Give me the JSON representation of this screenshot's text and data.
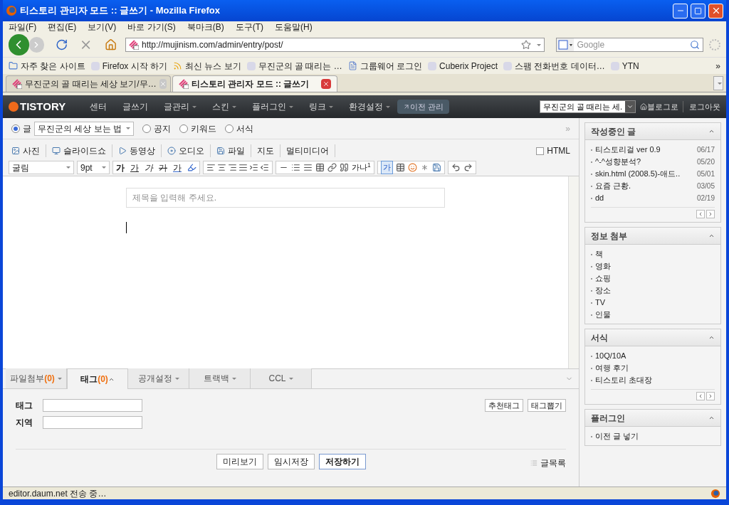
{
  "window": {
    "title": "티스토리 관리자 모드 :: 글쓰기 - Mozilla Firefox"
  },
  "menu": [
    "파일(F)",
    "편집(E)",
    "보기(V)",
    "바로 가기(S)",
    "북마크(B)",
    "도구(T)",
    "도움말(H)"
  ],
  "address": {
    "value": "http://mujinism.com/admin/entry/post/"
  },
  "search": {
    "placeholder": "Google"
  },
  "bookmarks": [
    "자주 찾은 사이트",
    "Firefox 시작 하기",
    "최신 뉴스 보기",
    "무진군의 골 때리는 …",
    "그룹웨어 로그인",
    "Cuberix Project",
    "스팸 전화번호 데이터…",
    "YTN"
  ],
  "bookmarks_more": "»",
  "tabs": [
    {
      "label": "무진군의 골 때리는 세상 보기/무…",
      "selected": false
    },
    {
      "label": "티스토리 관리자 모드 :: 글쓰기",
      "selected": true
    }
  ],
  "site_nav": {
    "logo": "TISTORY",
    "items": [
      {
        "label": "센터",
        "dropdown": false
      },
      {
        "label": "글쓰기",
        "dropdown": false
      },
      {
        "label": "글관리",
        "dropdown": true
      },
      {
        "label": "스킨",
        "dropdown": true
      },
      {
        "label": "플러그인",
        "dropdown": true
      },
      {
        "label": "링크",
        "dropdown": true
      },
      {
        "label": "환경설정",
        "dropdown": true
      }
    ],
    "old_admin": "이전 관리",
    "blog_select": "무진군의 골 때리는 세.",
    "blog_link": "블로그로",
    "logout": "로그아웃"
  },
  "post_types": [
    {
      "label": "글",
      "selected": true
    },
    {
      "label": "공지",
      "selected": false
    },
    {
      "label": "키워드",
      "selected": false
    },
    {
      "label": "서식",
      "selected": false
    }
  ],
  "category": "무진군의 세상 보는 법",
  "collapse": "»",
  "attach": [
    "사진",
    "슬라이드쇼",
    "동영상",
    "오디오",
    "파일",
    "지도",
    "멀티미디어"
  ],
  "html_mode": {
    "label": "HTML",
    "checked": false
  },
  "font": "굴림",
  "font_size": "9pt",
  "text_buttons": [
    {
      "label": "가",
      "kind": "bold"
    },
    {
      "label": "가",
      "kind": "underline"
    },
    {
      "label": "가",
      "kind": "italic"
    },
    {
      "label": "가",
      "kind": "strike"
    },
    {
      "label": "가",
      "kind": "color"
    }
  ],
  "footnote": "가나$^{1}$",
  "box_button": "가",
  "title_field": {
    "placeholder": "제목을 입력해 주세요."
  },
  "bottom_tabs": [
    {
      "label": "파일첨부",
      "count": "(0)",
      "selected": false
    },
    {
      "label": "태그",
      "count": "(0)",
      "selected": true
    },
    {
      "label": "공개설정",
      "selected": false
    },
    {
      "label": "트랙백",
      "selected": false
    },
    {
      "label": "CCL",
      "selected": false
    }
  ],
  "tag_form": {
    "fields": [
      "태그",
      "지역"
    ],
    "buttons": [
      "추천태그",
      "태그뽑기"
    ]
  },
  "actions": [
    {
      "label": "미리보기",
      "primary": false
    },
    {
      "label": "임시저장",
      "primary": false
    },
    {
      "label": "저장하기",
      "primary": true
    }
  ],
  "list_link": "글목록",
  "sidebar": [
    {
      "title": "작성중인 글",
      "items": [
        {
          "text": "티스토리걸 ver 0.9",
          "date": "06/17"
        },
        {
          "text": "^-^성향분석?",
          "date": "05/20"
        },
        {
          "text": "skin.html (2008.5)-애드..",
          "date": "05/01"
        },
        {
          "text": "요즘 근황.",
          "date": "03/05"
        },
        {
          "text": "dd",
          "date": "02/19"
        }
      ],
      "pager": true
    },
    {
      "title": "정보 첨부",
      "items": [
        {
          "text": "책"
        },
        {
          "text": "영화"
        },
        {
          "text": "쇼핑"
        },
        {
          "text": "장소"
        },
        {
          "text": "TV"
        },
        {
          "text": "인물"
        }
      ],
      "pager": false
    },
    {
      "title": "서식",
      "items": [
        {
          "text": "10Q/10A"
        },
        {
          "text": "여행 후기"
        },
        {
          "text": "티스토리 초대장"
        }
      ],
      "pager": true
    },
    {
      "title": "플러그인",
      "items": [
        {
          "text": "이전 글 넣기"
        }
      ],
      "pager": false
    }
  ],
  "status_bar": "editor.daum.net 전송 중…"
}
